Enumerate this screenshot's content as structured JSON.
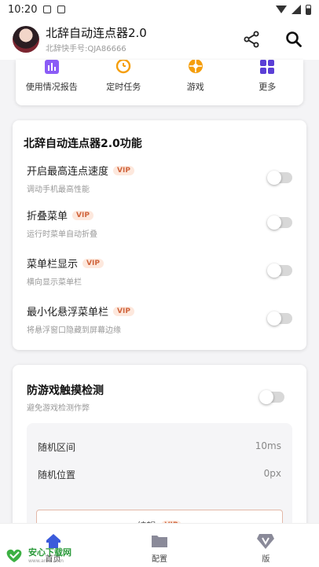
{
  "status_bar": {
    "time": "10:20"
  },
  "app_bar": {
    "title": "北辞自动连点器2.0",
    "subtitle": "北辞快手号:QJA86666"
  },
  "shortcuts": [
    {
      "label": "使用情况报告",
      "icon": "report-icon",
      "color": "#8b5cf6"
    },
    {
      "label": "定时任务",
      "icon": "timer-icon",
      "color": "#f59e0b"
    },
    {
      "label": "游戏",
      "icon": "game-icon",
      "color": "#f59e0b"
    },
    {
      "label": "更多",
      "icon": "more-grid-icon",
      "color": "#6d28d9"
    }
  ],
  "function_card": {
    "title": "北辞自动连点器2.0功能",
    "settings": [
      {
        "name": "开启最高连点速度",
        "badge": "VIP",
        "desc": "调动手机最高性能",
        "enabled": false
      },
      {
        "name": "折叠菜单",
        "badge": "VIP",
        "desc": "运行时菜单自动折叠",
        "enabled": false
      },
      {
        "name": "菜单栏显示",
        "badge": "VIP",
        "desc": "横向显示菜单栏",
        "enabled": false
      },
      {
        "name": "最小化悬浮菜单栏",
        "badge": "VIP",
        "desc": "将悬浮窗口隐藏到屏幕边缘",
        "enabled": false
      }
    ]
  },
  "anti_detect_card": {
    "title": "防游戏触摸检测",
    "desc": "避免游戏检测作弊",
    "enabled": false,
    "random_interval": {
      "label": "随机区间",
      "value": "10ms"
    },
    "random_position": {
      "label": "随机位置",
      "value": "0px"
    },
    "edit_button": {
      "label": "编辑",
      "badge": "VIP"
    }
  },
  "bottom_nav": [
    {
      "label": "首页",
      "icon": "home-icon",
      "active": true
    },
    {
      "label": "配置",
      "icon": "folder-icon",
      "active": false
    },
    {
      "label": "版",
      "icon": "vip-gem-icon",
      "active": false
    }
  ],
  "watermark": {
    "title": "安心下载网",
    "url": "www.anxz.com"
  },
  "colors": {
    "accent": "#3b5bdb",
    "vip_text": "#d0643c",
    "vip_bg": "#fde8dd",
    "background": "#f4f4f6"
  }
}
